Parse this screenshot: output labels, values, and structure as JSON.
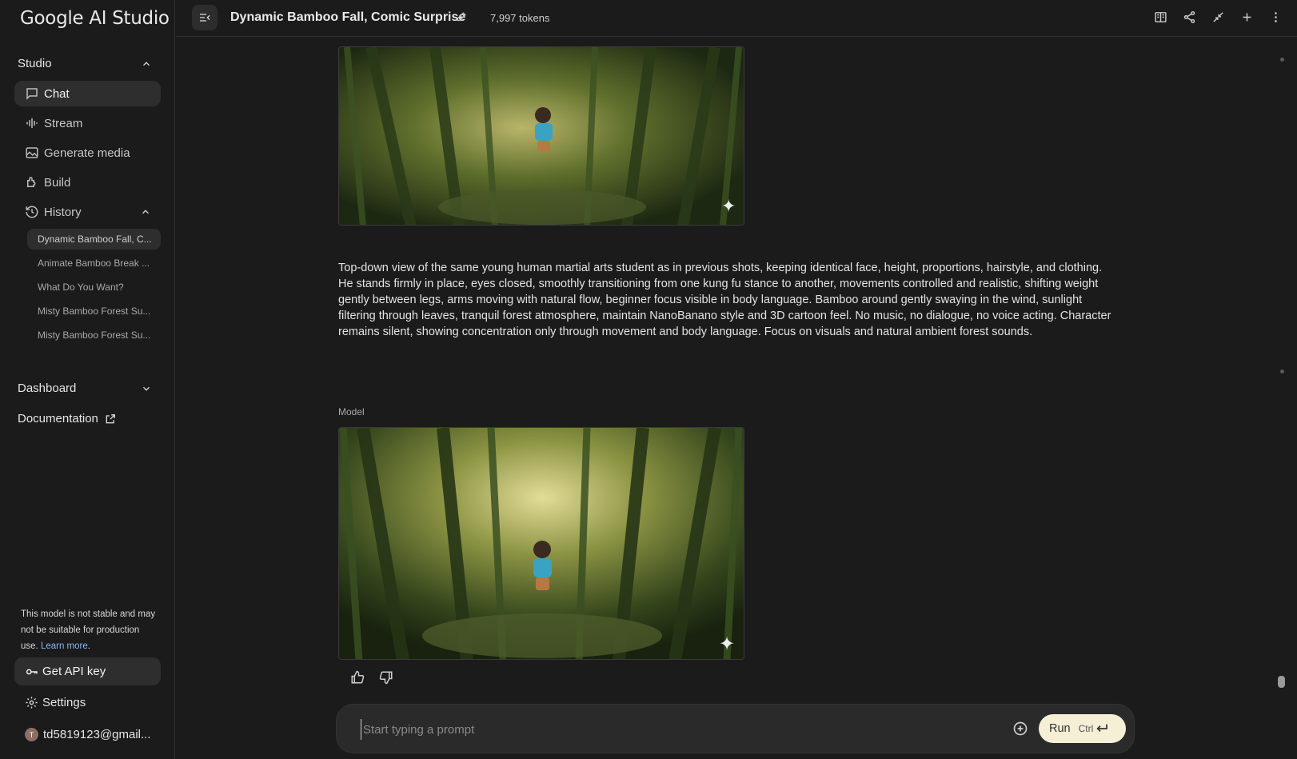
{
  "app": {
    "logo": "Google AI Studio"
  },
  "sidebar": {
    "studio_label": "Studio",
    "nav": [
      {
        "label": "Chat",
        "icon": "chat-icon",
        "active": true
      },
      {
        "label": "Stream",
        "icon": "stream-icon"
      },
      {
        "label": "Generate media",
        "icon": "image-icon"
      },
      {
        "label": "Build",
        "icon": "build-icon"
      },
      {
        "label": "History",
        "icon": "history-icon"
      }
    ],
    "history": [
      "Dynamic Bamboo Fall, C...",
      "Animate Bamboo Break ...",
      "What Do You Want?",
      "Misty Bamboo Forest Su...",
      "Misty Bamboo Forest Su..."
    ],
    "dashboard_label": "Dashboard",
    "documentation_label": "Documentation",
    "notice_text": "This model is not stable and may not be suitable for production use.",
    "notice_link": "Learn more",
    "api_key_label": "Get API key",
    "settings_label": "Settings",
    "account_initial": "T",
    "account_email": "td5819123@gmail..."
  },
  "header": {
    "title": "Dynamic Bamboo Fall, Comic Surprise",
    "tokens": "7,997 tokens"
  },
  "chat": {
    "user_prompt": "Top-down view of the same young human martial arts student as in previous shots, keeping identical face, height, proportions, hairstyle, and clothing. He stands firmly in place, eyes closed, smoothly transitioning from one kung fu stance to another, movements controlled and realistic, shifting weight gently between legs, arms moving with natural flow, beginner focus visible in body language. Bamboo around gently swaying in the wind, sunlight filtering through leaves, tranquil forest atmosphere, maintain NanoBanano style and 3D cartoon feel. No music, no dialogue, no voice acting. Character remains silent, showing concentration only through movement and body language. Focus on visuals and natural ambient forest sounds.",
    "model_label": "Model"
  },
  "input": {
    "placeholder": "Start typing a prompt",
    "run_label": "Run",
    "shortcut": "Ctrl"
  },
  "colors": {
    "background": "#1b1b1b",
    "active_item": "#2e2e2e",
    "run_button": "#f5efd6",
    "link": "#8ab4f8"
  }
}
